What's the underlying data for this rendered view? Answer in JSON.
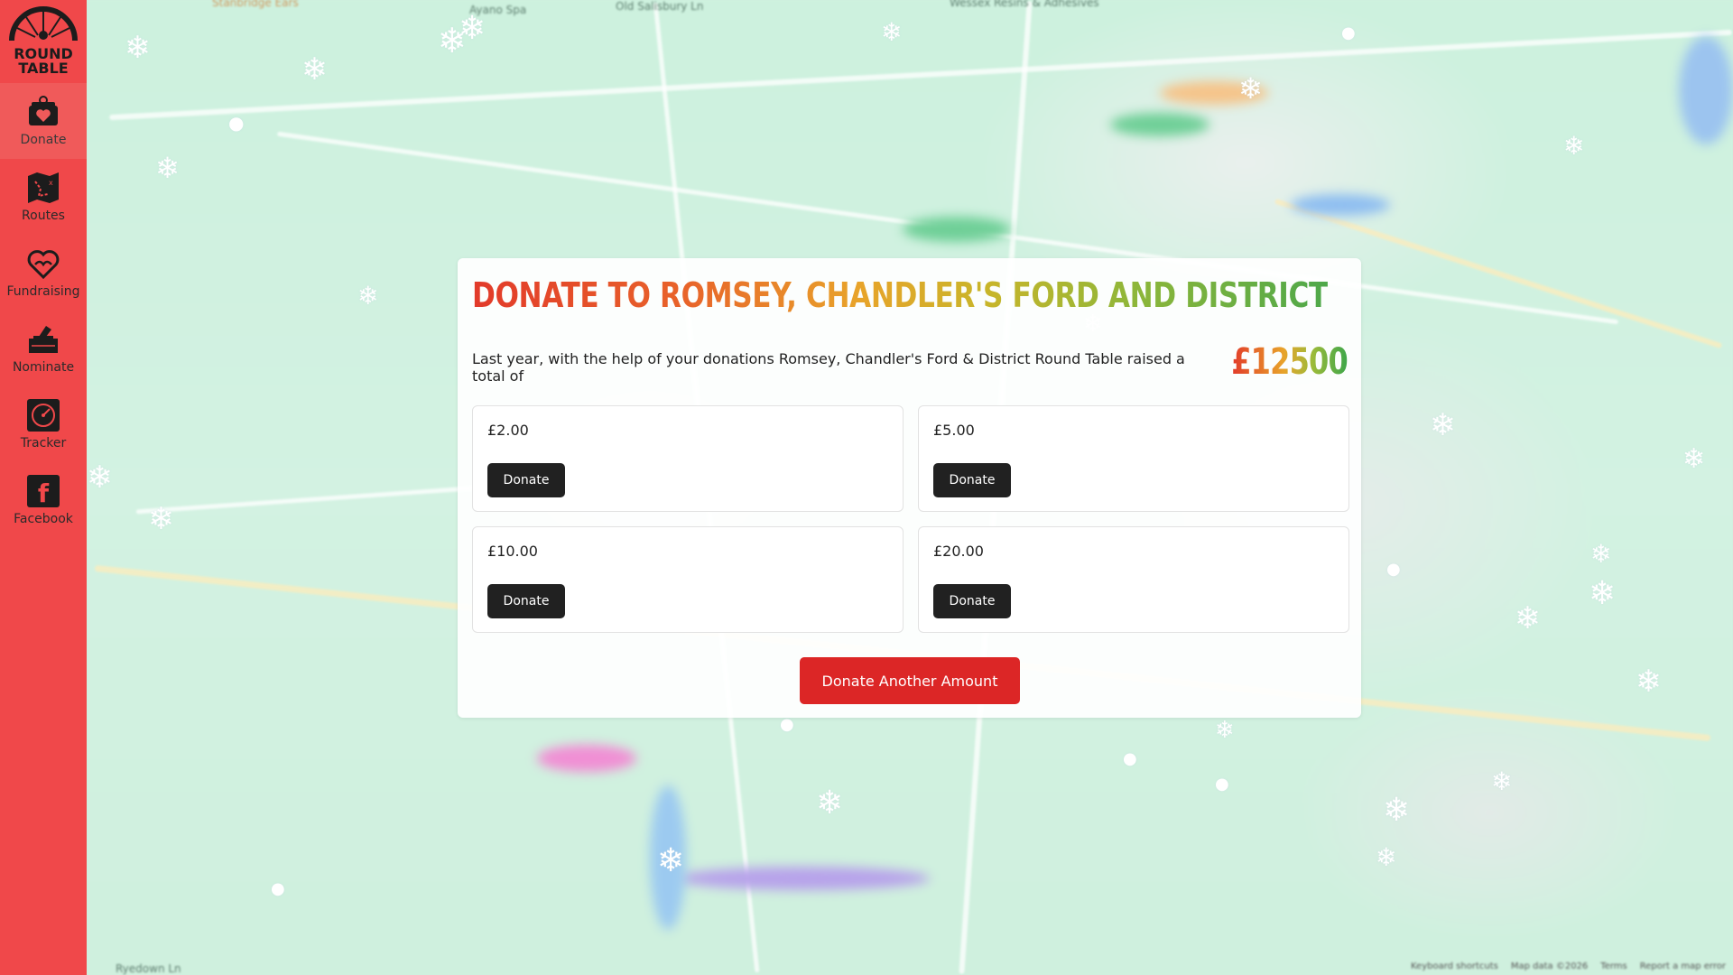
{
  "sidebar": {
    "logo_text": "ROUND TABLE",
    "items": [
      {
        "label": "Donate",
        "icon": "donate-icon",
        "active": true
      },
      {
        "label": "Routes",
        "icon": "map-routes-icon",
        "active": false
      },
      {
        "label": "Fundraising",
        "icon": "heart-hands-icon",
        "active": false
      },
      {
        "label": "Nominate",
        "icon": "ballot-box-icon",
        "active": false
      },
      {
        "label": "Tracker",
        "icon": "tracker-icon",
        "active": false
      },
      {
        "label": "Facebook",
        "icon": "facebook-icon",
        "active": false
      }
    ]
  },
  "donation": {
    "title": "Donate to Romsey, Chandler's Ford and District",
    "intro": "Last year, with the help of your donations Romsey, Chandler's Ford & District Round Table raised a total of",
    "total": "£12500",
    "options": [
      {
        "amount": "£2.00",
        "button": "Donate"
      },
      {
        "amount": "£5.00",
        "button": "Donate"
      },
      {
        "amount": "£10.00",
        "button": "Donate"
      },
      {
        "amount": "£20.00",
        "button": "Donate"
      }
    ],
    "another_button": "Donate Another Amount"
  },
  "map": {
    "labels": [
      "Stanbridge Ears",
      "Ayano Spa",
      "Old Salisbury Ln",
      "Wessex Resins & Adhesives",
      "Ryedown Ln"
    ],
    "footer": [
      "Keyboard shortcuts",
      "Map data ©2026",
      "Terms",
      "Report a map error"
    ]
  },
  "colors": {
    "sidebar": "#f0484a",
    "accent_button": "#dc2626",
    "dark_button": "#212121"
  }
}
